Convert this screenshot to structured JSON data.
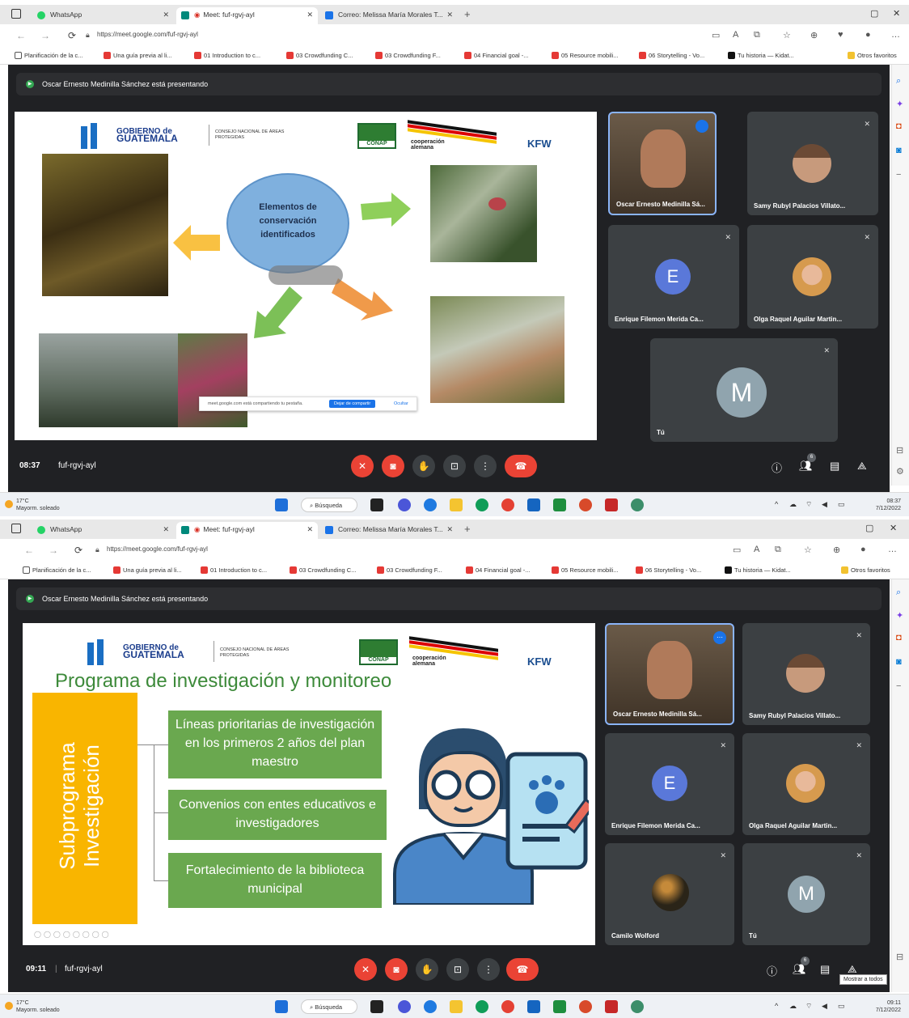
{
  "browser": {
    "tabs": [
      {
        "label": "WhatsApp"
      },
      {
        "label": "Meet: fuf-rgvj-ayl"
      },
      {
        "label": "Correo: Melissa María Morales T..."
      }
    ],
    "url": "https://meet.google.com/fuf-rgvj-ayl",
    "bookmarks": [
      "Planificación de la c...",
      "Una guía previa al li...",
      "01 Introduction to c...",
      "03 Crowdfunding C...",
      "03 Crowdfunding F...",
      "04 Financial goal -...",
      "05 Resource mobili...",
      "06 Storytelling - Vo...",
      "Tu historia — Kidat...",
      "Otros favoritos"
    ]
  },
  "meeting": {
    "presenting_text": "Oscar Ernesto Medinilla Sánchez está presentando",
    "code": "fuf-rgvj-ayl",
    "participants_count": "6"
  },
  "screens": [
    {
      "time": "08:37",
      "participants": [
        {
          "name": "Oscar Ernesto Medinilla Sá..."
        },
        {
          "name": "Samy Rubyl Palacios Villato..."
        },
        {
          "name": "Enrique Filemon Merida Ca...",
          "initial": "E"
        },
        {
          "name": "Olga Raquel Aguilar Martin..."
        },
        {
          "name": "Tú",
          "initial": "M"
        }
      ],
      "slide": {
        "gob_line1": "GOBIERNO de",
        "gob_line2": "GUATEMALA",
        "conap_text": "CONSEJO NACIONAL DE ÁREAS PROTEGIDAS",
        "conap_logo": "CONAP",
        "coop_line1": "cooperación",
        "coop_line2": "alemana",
        "kfw": "KFW",
        "circle_text": "Elementos de conservación identificados",
        "toast_text": "meet.google.com está compartiendo tu pestaña.",
        "toast_btn": "Dejar de compartir",
        "toast_hide": "Ocultar"
      },
      "taskbar": {
        "temp": "17°C",
        "weather": "Mayorm. soleado",
        "search": "Búsqueda",
        "clock": "08:37",
        "date": "7/12/2022"
      }
    },
    {
      "time": "09:11",
      "participants": [
        {
          "name": "Oscar Ernesto Medinilla Sá..."
        },
        {
          "name": "Samy Rubyl Palacios Villato..."
        },
        {
          "name": "Enrique Filemon Merida Ca...",
          "initial": "E"
        },
        {
          "name": "Olga Raquel Aguilar Martin..."
        },
        {
          "name": "Camilo Wolford"
        },
        {
          "name": "Tú",
          "initial": "M"
        }
      ],
      "slide": {
        "title": "Programa de investigación y monitoreo",
        "subprogram_line1": "Subprograma",
        "subprogram_line2": "Investigación",
        "box1": "Líneas prioritarias de investigación en los primeros 2 años del plan maestro",
        "box2": "Convenios con entes educativos e investigadores",
        "box3": "Fortalecimiento de la biblioteca municipal"
      },
      "tooltip": "Mostrar a todos",
      "taskbar": {
        "temp": "17°C",
        "weather": "Mayorm. soleado",
        "search": "Búsqueda",
        "clock": "09:11",
        "date": "7/12/2022"
      }
    }
  ],
  "colors": {
    "meet_bg": "#202124",
    "tile_bg": "#3c4043",
    "end_call": "#ea4335",
    "sub_yellow": "#f9b500",
    "box_green": "#6aa84f",
    "avatar_blue": "#5a78d9",
    "avatar_gray": "#90a4ae"
  }
}
